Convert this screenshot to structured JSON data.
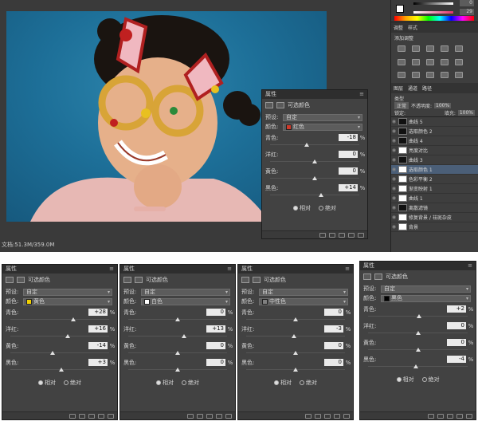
{
  "document": {
    "status": "文档:51.3M/359.0M"
  },
  "right_panel": {
    "color_values": [
      "0",
      "29"
    ],
    "tabs1": [
      "调整",
      "样式"
    ],
    "add_adjustment": "添加调整",
    "tabs2": [
      "图层",
      "通道",
      "路径"
    ],
    "kind_label": "类型",
    "blend_mode": "正常",
    "opacity_label": "不透明度:",
    "opacity": "100%",
    "lock_label": "锁定:",
    "fill_label": "填充:",
    "fill": "100%",
    "layers": [
      {
        "name": "曲线 5",
        "thumb": "dark"
      },
      {
        "name": "选取颜色 2",
        "thumb": "dark"
      },
      {
        "name": "曲线 4",
        "thumb": "dark"
      },
      {
        "name": "亮度对比",
        "thumb": "light"
      },
      {
        "name": "曲线 3",
        "thumb": "dark"
      },
      {
        "name": "选取颜色 1",
        "thumb": "light",
        "selected": true
      },
      {
        "name": "色彩平衡 2",
        "thumb": "light"
      },
      {
        "name": "渐变映射 1",
        "thumb": "light"
      },
      {
        "name": "曲线 1",
        "thumb": "light"
      },
      {
        "name": "离散滤镜",
        "thumb": "dark"
      },
      {
        "name": "修复背景 / 祛斑杂皮",
        "thumb": "light"
      },
      {
        "name": "背景",
        "thumb": "light"
      }
    ]
  },
  "panels": [
    {
      "header": "属性",
      "title": "可选颜色",
      "preset_label": "预设:",
      "preset_value": "自定",
      "color_label": "颜色:",
      "color_name": "红色",
      "color_hex": "#d03a2a",
      "sliders": [
        {
          "label": "青色:",
          "value": "-18",
          "pos": 0.41
        },
        {
          "label": "洋红:",
          "value": "0",
          "pos": 0.5
        },
        {
          "label": "黄色:",
          "value": "0",
          "pos": 0.5
        },
        {
          "label": "黑色:",
          "value": "+14",
          "pos": 0.57
        }
      ],
      "radio1": "相对",
      "radio2": "绝对"
    },
    {
      "header": "属性",
      "title": "可选颜色",
      "preset_label": "预设:",
      "preset_value": "自定",
      "color_label": "颜色:",
      "color_name": "黄色",
      "color_hex": "#f0d000",
      "sliders": [
        {
          "label": "青色:",
          "value": "+28",
          "pos": 0.64
        },
        {
          "label": "洋红:",
          "value": "+16",
          "pos": 0.58
        },
        {
          "label": "黄色:",
          "value": "-14",
          "pos": 0.43
        },
        {
          "label": "黑色:",
          "value": "+3",
          "pos": 0.515
        }
      ],
      "radio1": "相对",
      "radio2": "绝对"
    },
    {
      "header": "属性",
      "title": "可选颜色",
      "preset_label": "预设:",
      "preset_value": "自定",
      "color_label": "颜色:",
      "color_name": "白色",
      "color_hex": "#ffffff",
      "sliders": [
        {
          "label": "青色:",
          "value": "0",
          "pos": 0.5
        },
        {
          "label": "洋红:",
          "value": "+13",
          "pos": 0.565
        },
        {
          "label": "黄色:",
          "value": "0",
          "pos": 0.5
        },
        {
          "label": "黑色:",
          "value": "0",
          "pos": 0.5
        }
      ],
      "radio1": "相对",
      "radio2": "绝对"
    },
    {
      "header": "属性",
      "title": "可选颜色",
      "preset_label": "预设:",
      "preset_value": "自定",
      "color_label": "颜色:",
      "color_name": "中性色",
      "color_hex": "#808080",
      "sliders": [
        {
          "label": "青色:",
          "value": "0",
          "pos": 0.5
        },
        {
          "label": "洋红:",
          "value": "-3",
          "pos": 0.485
        },
        {
          "label": "黄色:",
          "value": "0",
          "pos": 0.5
        },
        {
          "label": "黑色:",
          "value": "0",
          "pos": 0.5
        }
      ],
      "radio1": "相对",
      "radio2": "绝对"
    },
    {
      "header": "属性",
      "title": "可选颜色",
      "preset_label": "预设:",
      "preset_value": "自定",
      "color_label": "颜色:",
      "color_name": "黑色",
      "color_hex": "#000000",
      "sliders": [
        {
          "label": "青色:",
          "value": "+2",
          "pos": 0.51
        },
        {
          "label": "洋红:",
          "value": "0",
          "pos": 0.5
        },
        {
          "label": "黄色:",
          "value": "0",
          "pos": 0.5
        },
        {
          "label": "黑色:",
          "value": "-4",
          "pos": 0.48
        }
      ],
      "radio1": "相对",
      "radio2": "绝对"
    }
  ]
}
